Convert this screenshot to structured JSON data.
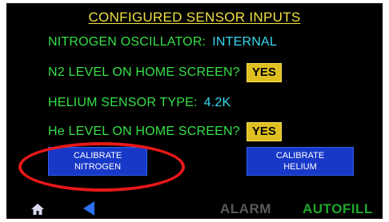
{
  "screen": {
    "title": "CONFIGURED SENSOR INPUTS"
  },
  "rows": [
    {
      "label": "NITROGEN OSCILLATOR:",
      "value": "INTERNAL"
    },
    {
      "label": "N2 LEVEL ON HOME SCREEN?",
      "button": "YES"
    },
    {
      "label": "HELIUM SENSOR TYPE:",
      "value": "4.2K"
    },
    {
      "label": "He LEVEL ON HOME SCREEN?",
      "button": "YES"
    }
  ],
  "buttons": {
    "calibrate_nitrogen": {
      "line1": "CALIBRATE",
      "line2": "NITROGEN"
    },
    "calibrate_helium": {
      "line1": "CALIBRATE",
      "line2": "HELIUM"
    }
  },
  "footer": {
    "home_icon": "home-icon",
    "back_icon": "back-arrow-icon",
    "alarm": "ALARM",
    "autofill": "AUTOFILL"
  },
  "colors": {
    "label_green": "#36e048",
    "value_cyan": "#38d8f0",
    "title_yellow": "#f0e040",
    "button_blue": "#1838c8",
    "yes_yellow": "#e0c020",
    "alarm_gray": "#5a5a5a",
    "autofill_green": "#1fa82c",
    "highlight_red": "#e81818"
  }
}
